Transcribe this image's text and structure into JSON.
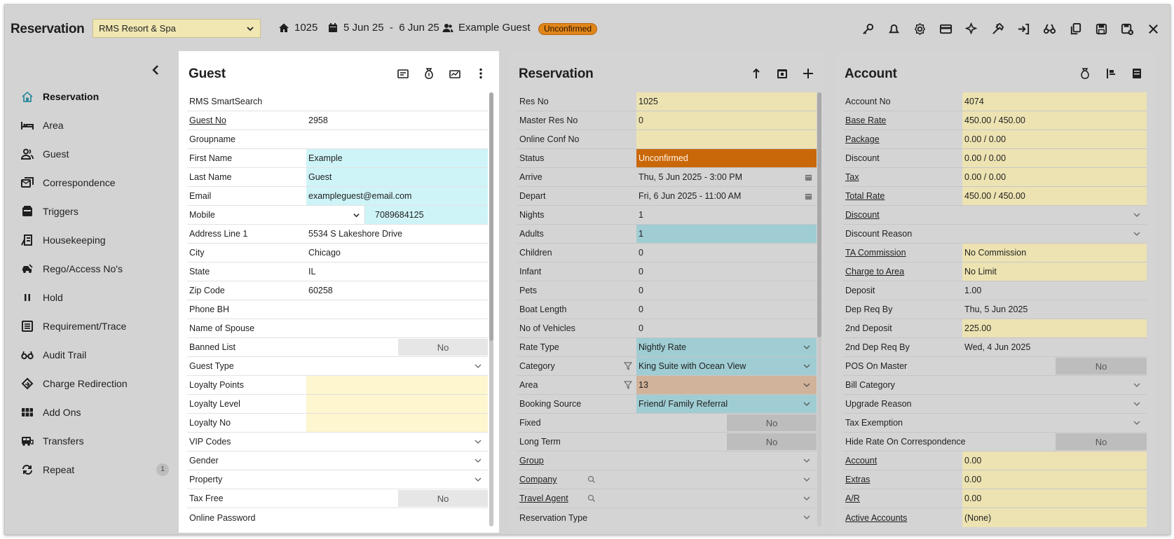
{
  "header": {
    "title": "Reservation",
    "property": "RMS Resort & Spa",
    "area_no": "1025",
    "dates": "5 Jun 25  -  6 Jun 25",
    "guest": "Example Guest",
    "status": "Unconfirmed"
  },
  "sidebar": {
    "items": [
      {
        "label": "Reservation",
        "icon": "home-icon"
      },
      {
        "label": "Area",
        "icon": "bed-icon"
      },
      {
        "label": "Guest",
        "icon": "users-icon"
      },
      {
        "label": "Correspondence",
        "icon": "mail-icon"
      },
      {
        "label": "Triggers",
        "icon": "trigger-icon"
      },
      {
        "label": "Housekeeping",
        "icon": "housekeeping-icon"
      },
      {
        "label": "Rego/Access No's",
        "icon": "car-icon"
      },
      {
        "label": "Hold",
        "icon": "pause-icon"
      },
      {
        "label": "Requirement/Trace",
        "icon": "list-icon"
      },
      {
        "label": "Audit Trail",
        "icon": "glasses-icon"
      },
      {
        "label": "Charge Redirection",
        "icon": "redirect-icon"
      },
      {
        "label": "Add Ons",
        "icon": "addons-icon"
      },
      {
        "label": "Transfers",
        "icon": "bus-icon"
      },
      {
        "label": "Repeat",
        "icon": "repeat-icon",
        "count": "1"
      }
    ]
  },
  "guest_panel": {
    "title": "Guest",
    "rows": [
      {
        "label": "RMS SmartSearch",
        "value": ""
      },
      {
        "label": "Guest No",
        "value": "2958"
      },
      {
        "label": "Groupname",
        "value": ""
      },
      {
        "label": "First Name",
        "value": "Example"
      },
      {
        "label": "Last Name",
        "value": "Guest"
      },
      {
        "label": "Email",
        "value": "exampleguest@email.com"
      },
      {
        "label": "Mobile",
        "value": "7089684125"
      },
      {
        "label": "Address Line 1",
        "value": "5534 S Lakeshore Drive"
      },
      {
        "label": "City",
        "value": "Chicago"
      },
      {
        "label": "State",
        "value": "IL"
      },
      {
        "label": "Zip Code",
        "value": "60258"
      },
      {
        "label": "Phone BH",
        "value": ""
      },
      {
        "label": "Name of Spouse",
        "value": ""
      },
      {
        "label": "Banned List",
        "value": "No"
      },
      {
        "label": "Guest Type",
        "value": ""
      },
      {
        "label": "Loyalty Points",
        "value": ""
      },
      {
        "label": "Loyalty Level",
        "value": ""
      },
      {
        "label": "Loyalty No",
        "value": ""
      },
      {
        "label": "VIP Codes",
        "value": ""
      },
      {
        "label": "Gender",
        "value": ""
      },
      {
        "label": "Property",
        "value": ""
      },
      {
        "label": "Tax Free",
        "value": "No"
      },
      {
        "label": "Online Password",
        "value": ""
      }
    ]
  },
  "res_panel": {
    "title": "Reservation",
    "rows": [
      {
        "label": "Res No",
        "value": "1025"
      },
      {
        "label": "Master Res No",
        "value": "0"
      },
      {
        "label": "Online Conf No",
        "value": ""
      },
      {
        "label": "Status",
        "value": "Unconfirmed"
      },
      {
        "label": "Arrive",
        "value": "Thu, 5 Jun 2025 - 3:00 PM"
      },
      {
        "label": "Depart",
        "value": "Fri, 6 Jun 2025 - 11:00 AM"
      },
      {
        "label": "Nights",
        "value": "1"
      },
      {
        "label": "Adults",
        "value": "1"
      },
      {
        "label": "Children",
        "value": "0"
      },
      {
        "label": "Infant",
        "value": "0"
      },
      {
        "label": "Pets",
        "value": "0"
      },
      {
        "label": "Boat Length",
        "value": "0"
      },
      {
        "label": "No of Vehicles",
        "value": "0"
      },
      {
        "label": "Rate Type",
        "value": "Nightly Rate"
      },
      {
        "label": "Category",
        "value": "King Suite with Ocean View"
      },
      {
        "label": "Area",
        "value": "13"
      },
      {
        "label": "Booking Source",
        "value": "Friend/ Family Referral"
      },
      {
        "label": "Fixed",
        "value": "No"
      },
      {
        "label": "Long Term",
        "value": "No"
      },
      {
        "label": "Group",
        "value": ""
      },
      {
        "label": "Company",
        "value": ""
      },
      {
        "label": "Travel Agent",
        "value": ""
      },
      {
        "label": "Reservation Type",
        "value": ""
      }
    ]
  },
  "acc_panel": {
    "title": "Account",
    "rows": [
      {
        "label": "Account No",
        "value": "4074"
      },
      {
        "label": "Base Rate",
        "value": "450.00 / 450.00"
      },
      {
        "label": "Package",
        "value": "0.00 / 0.00"
      },
      {
        "label": "Discount",
        "value": "0.00 / 0.00"
      },
      {
        "label": "Tax",
        "value": "0.00 / 0.00"
      },
      {
        "label": "Total Rate",
        "value": "450.00 / 450.00"
      },
      {
        "label": "Discount",
        "value": ""
      },
      {
        "label": "Discount Reason",
        "value": ""
      },
      {
        "label": "TA Commission",
        "value": "No Commission"
      },
      {
        "label": "Charge to Area",
        "value": "No Limit"
      },
      {
        "label": "Deposit",
        "value": "1.00"
      },
      {
        "label": "Dep Req By",
        "value": "Thu, 5 Jun 2025"
      },
      {
        "label": "2nd Deposit",
        "value": "225.00"
      },
      {
        "label": "2nd Dep Req By",
        "value": "Wed, 4 Jun 2025"
      },
      {
        "label": "POS On Master",
        "value": "No"
      },
      {
        "label": "Bill Category",
        "value": ""
      },
      {
        "label": "Upgrade Reason",
        "value": ""
      },
      {
        "label": "Tax Exemption",
        "value": ""
      },
      {
        "label": "Hide Rate On Correspondence",
        "value": "No"
      },
      {
        "label": "Account",
        "value": "0.00"
      },
      {
        "label": "Extras",
        "value": "0.00"
      },
      {
        "label": "A/R",
        "value": "0.00"
      },
      {
        "label": "Active Accounts",
        "value": "(None)"
      }
    ]
  },
  "colors": {
    "status_badge": "#e0861a",
    "field_yellow": "#ede3b2",
    "field_cyan": "#cff4f8",
    "status_orange": "#c96808",
    "field_teal": "#9fcdd3",
    "field_tan": "#d1b29a"
  }
}
